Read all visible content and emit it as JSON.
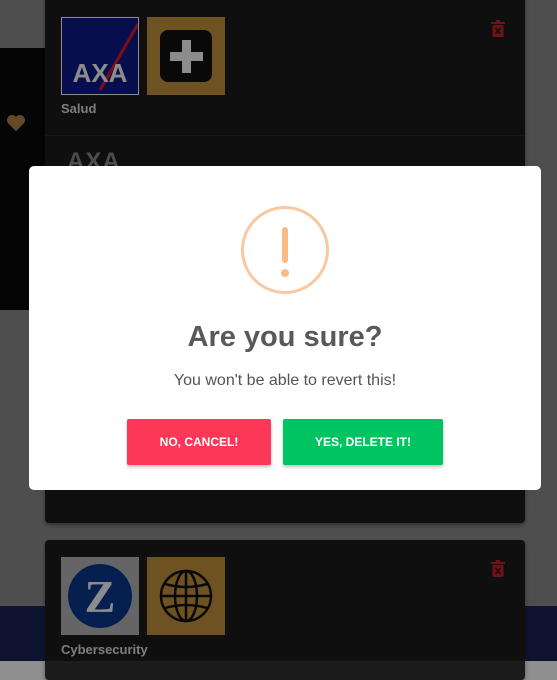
{
  "background": {
    "heart_icon": "heart-icon",
    "cards": [
      {
        "logos": [
          "axa-logo",
          "plus-icon"
        ],
        "axa_logo_text": "AXA",
        "category": "Salud",
        "trash_icon": "trash-icon",
        "partial_text": "AXA"
      },
      {
        "logos": [
          "zurich-logo",
          "globe-icon"
        ],
        "zurich_logo_text": "Z",
        "category": "Cybersecurity",
        "trash_icon": "trash-icon"
      }
    ]
  },
  "dialog": {
    "icon": "warning-icon",
    "title": "Are you sure?",
    "text": "You won't be able to revert this!",
    "cancel_label": "NO, CANCEL!",
    "confirm_label": "YES, DELETE IT!"
  },
  "colors": {
    "cancel": "#fc3757",
    "confirm": "#00c462",
    "warning": "#f8bb86",
    "trash": "#c8222c",
    "gold": "#c8963e"
  }
}
